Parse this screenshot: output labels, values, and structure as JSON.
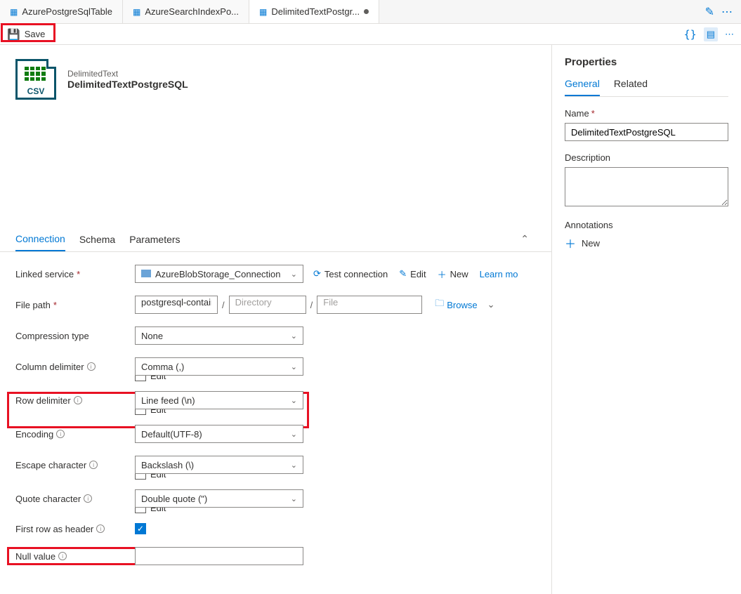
{
  "tabs": [
    {
      "label": "AzurePostgreSqlTable"
    },
    {
      "label": "AzureSearchIndexPo..."
    },
    {
      "label": "DelimitedTextPostgr...",
      "active": true,
      "dirty": true
    }
  ],
  "save_label": "Save",
  "csv_label": "CSV",
  "dataset": {
    "type": "DelimitedText",
    "name": "DelimitedTextPostgreSQL"
  },
  "inner_tabs": {
    "connection": "Connection",
    "schema": "Schema",
    "parameters": "Parameters"
  },
  "form": {
    "linked_service_label": "Linked service",
    "linked_service_value": "AzureBlobStorage_Connection",
    "test_connection": "Test connection",
    "edit": "Edit",
    "new": "New",
    "learn_more": "Learn mo",
    "file_path_label": "File path",
    "file_path_container": "postgresql-container",
    "file_path_dir_ph": "Directory",
    "file_path_file_ph": "File",
    "browse": "Browse",
    "compression_label": "Compression type",
    "compression_value": "None",
    "coldelim_label": "Column delimiter",
    "coldelim_value": "Comma (,)",
    "rowdelim_label": "Row delimiter",
    "rowdelim_value": "Line feed (\\n)",
    "encoding_label": "Encoding",
    "encoding_value": "Default(UTF-8)",
    "escape_label": "Escape character",
    "escape_value": "Backslash (\\)",
    "quote_label": "Quote character",
    "quote_value": "Double quote (\")",
    "firstrow_label": "First row as header",
    "firstrow_checked": true,
    "null_label": "Null value",
    "edit_chk": "Edit"
  },
  "properties": {
    "title": "Properties",
    "tab_general": "General",
    "tab_related": "Related",
    "name_label": "Name",
    "name_value": "DelimitedTextPostgreSQL",
    "description_label": "Description",
    "annotations_label": "Annotations",
    "new_label": "New"
  }
}
